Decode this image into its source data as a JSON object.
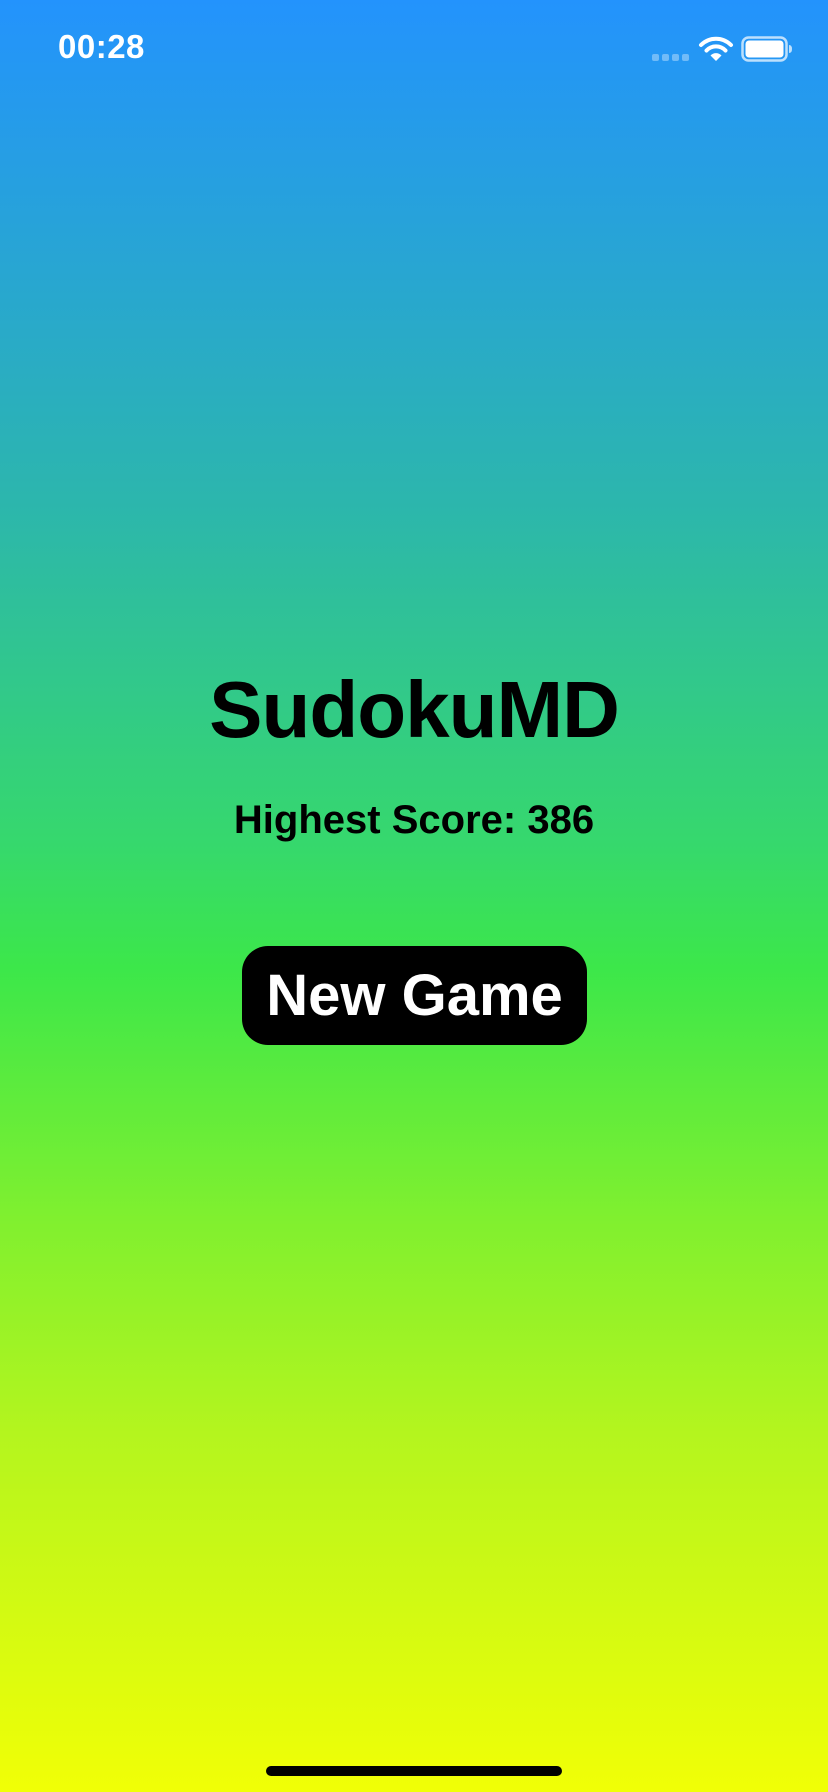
{
  "status_bar": {
    "time": "00:28",
    "icons": [
      "cellular-signal-icon",
      "wifi-icon",
      "battery-icon"
    ],
    "battery_level": 1.0
  },
  "main": {
    "title": "SudokuMD",
    "score_label": "Highest Score: ",
    "score_value": "386",
    "new_game_label": "New Game"
  },
  "colors": {
    "gradient_top": "#2393fd",
    "gradient_middle": "#3ce74a",
    "gradient_bottom": "#f1ff06",
    "text": "#000000",
    "button_background": "#000000",
    "button_text": "#ffffff"
  }
}
